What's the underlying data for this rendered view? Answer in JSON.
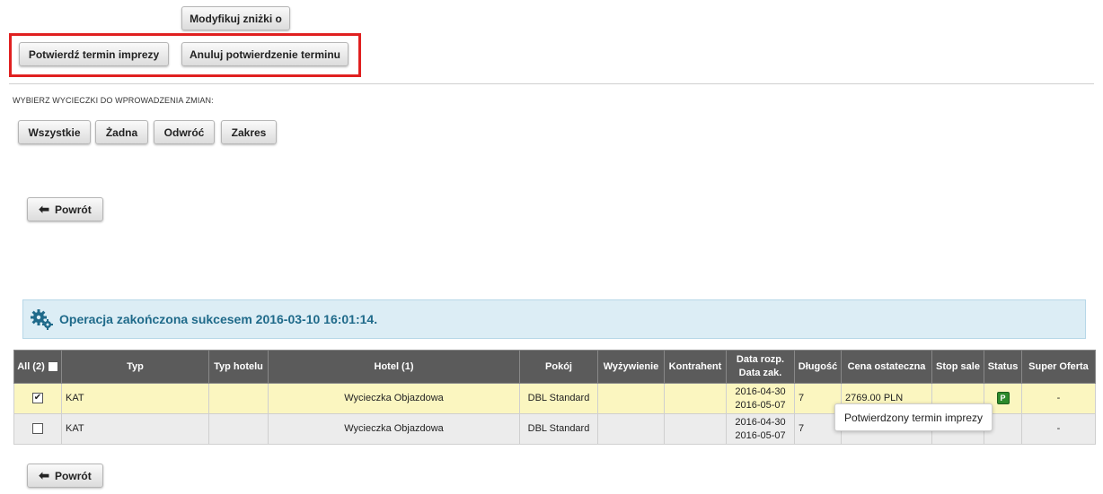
{
  "top_buttons": {
    "modify_discounts": "Modyfikuj zniżki o",
    "confirm_term": "Potwierdź termin imprezy",
    "cancel_confirm": "Anuluj potwierdzenie terminu"
  },
  "selection": {
    "label": "WYBIERZ WYCIECZKI DO WPROWADZENIA ZMIAN:",
    "all": "Wszystkie",
    "none": "Żadna",
    "invert": "Odwróć",
    "range": "Zakres"
  },
  "back_label": "Powrót",
  "success_message": "Operacja zakończona sukcesem 2016-03-10 16:01:14.",
  "table": {
    "headers": {
      "all": "All (2)",
      "type": "Typ",
      "hotel_type": "Typ hotelu",
      "hotel": "Hotel (1)",
      "room": "Pokój",
      "board": "Wyżywienie",
      "contractor": "Kontrahent",
      "date_start": "Data rozp.",
      "date_end": "Data zak.",
      "length": "Długość",
      "final_price": "Cena ostateczna",
      "stop_sale": "Stop sale",
      "status": "Status",
      "super_offer": "Super Oferta"
    },
    "rows": [
      {
        "checked": true,
        "type": "KAT",
        "hotel_type": "",
        "hotel": "Wycieczka Objazdowa",
        "room": "DBL Standard",
        "board": "",
        "contractor": "",
        "date_start": "2016-04-30",
        "date_end": "2016-05-07",
        "length": "7",
        "final_price": "2769.00 PLN",
        "stop_sale": "",
        "status": "P",
        "super_offer": "-"
      },
      {
        "checked": false,
        "type": "KAT",
        "hotel_type": "",
        "hotel": "Wycieczka Objazdowa",
        "room": "DBL Standard",
        "board": "",
        "contractor": "",
        "date_start": "2016-04-30",
        "date_end": "2016-05-07",
        "length": "7",
        "final_price": "",
        "stop_sale": "",
        "status": "",
        "super_offer": "-"
      }
    ]
  },
  "tooltip": "Potwierdzony termin imprezy",
  "colors": {
    "highlight": "#e02020",
    "header_bg": "#5b5b5b",
    "row_selected": "#fbf6c0",
    "status_ok": "#2c8a2c"
  }
}
